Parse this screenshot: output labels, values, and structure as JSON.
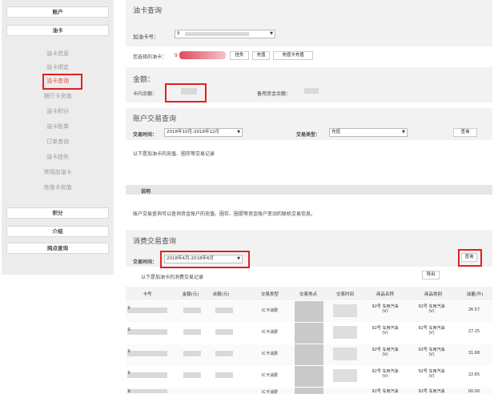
{
  "sidebar": {
    "account": "账户",
    "card": "油卡",
    "items": [
      "油卡信息",
      "油卡绑定",
      "油卡查询",
      "银行卡充值",
      "油卡积分",
      "油卡账单",
      "订单查询",
      "油卡挂失",
      "常用加油卡",
      "充值卡充值"
    ],
    "points": "积分",
    "intro": "介绍",
    "outlets": "网点查询"
  },
  "query": {
    "title": "油卡查询",
    "card_label": "加油卡号：",
    "card_value": "9",
    "selected_label": "您选择的油卡：",
    "selected_value": "9",
    "btn_report": "挂失",
    "btn_recharge": "充值",
    "btn_card_recharge": "充值卡充值"
  },
  "balance": {
    "title": "金额：",
    "card_balance_label": "卡内余额：",
    "reserve_label": "备用资金余额："
  },
  "account_tx": {
    "title": "账户交易查询",
    "time_label": "交易时间：",
    "time_value": "2018年10月-2018年12月",
    "type_label": "交易类型：",
    "type_value": "充值",
    "query_btn": "查询",
    "desc": "以下是加油卡的充值、圈存等交易记录"
  },
  "notes": {
    "title": "说明",
    "text": "账户交易查询可以查询资金账户的充值、圈存、圈提等资金账户变动的联机交易信息。"
  },
  "consume_tx": {
    "title": "消费交易查询",
    "time_label": "交易时间：",
    "time_value": "2018年4月-2018年6月",
    "query_btn": "查询",
    "export_btn": "导出",
    "desc": "以下是加油卡的消费交易记录",
    "headers": [
      "卡号",
      "金额(元)",
      "余额(元)",
      "交易类型",
      "交易地点",
      "交易时间",
      "商品名称",
      "商品类别",
      "油量(升)"
    ],
    "rows": [
      {
        "prefix": "9",
        "type": "IC卡消费",
        "product": "92号 车用汽油(V)",
        "category": "92号 车用汽油(V)",
        "volume": "26.57"
      },
      {
        "prefix": "9",
        "type": "IC卡消费",
        "product": "92号 车用汽油(V)",
        "category": "92号 车用汽油(V)",
        "volume": "27.25"
      },
      {
        "prefix": "9",
        "type": "IC卡消费",
        "product": "92号 车用汽油(V)",
        "category": "92号 车用汽油(V)",
        "volume": "31.68"
      },
      {
        "prefix": "9",
        "type": "IC卡消费",
        "product": "92号 车用汽油(V)",
        "category": "92号 车用汽油(V)",
        "volume": "22.65"
      },
      {
        "prefix": "9",
        "type": "IC卡消费",
        "product": "92号 车用汽油(V)",
        "category": "92号 车用汽油(V)",
        "volume": "00.00"
      }
    ]
  },
  "colors": {
    "highlight": "#e02020",
    "active_link": "#e05353",
    "panel_bg": "#efefef",
    "sidebar_bg": "#ececec"
  }
}
